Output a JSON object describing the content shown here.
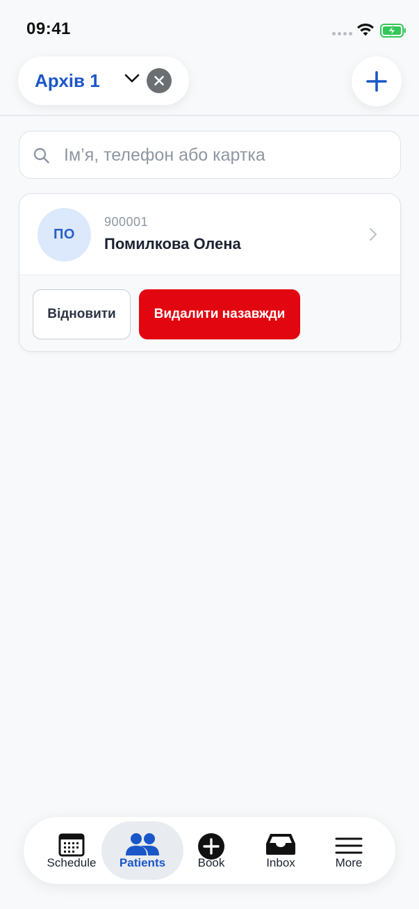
{
  "status_bar": {
    "time": "09:41"
  },
  "header": {
    "filter_label": "Архів 1",
    "icons": {
      "chevron": "chevron-down-icon",
      "clear": "close-icon",
      "add": "plus-icon"
    }
  },
  "search": {
    "placeholder": "Ім’я, телефон або картка",
    "value": ""
  },
  "patients": [
    {
      "initials": "ПО",
      "card_number": "900001",
      "name": "Помилкова Олена",
      "restore_label": "Відновити",
      "delete_label": "Видалити назавжди"
    }
  ],
  "tab_bar": {
    "tabs": [
      {
        "label": "Schedule",
        "icon": "calendar-icon",
        "active": false
      },
      {
        "label": "Patients",
        "icon": "users-icon",
        "active": true
      },
      {
        "label": "Book",
        "icon": "plus-circle-icon",
        "active": false
      },
      {
        "label": "Inbox",
        "icon": "inbox-icon",
        "active": false
      },
      {
        "label": "More",
        "icon": "menu-icon",
        "active": false
      }
    ]
  },
  "colors": {
    "accent": "#1a56c8",
    "danger": "#e20610",
    "background": "#f7f9fb"
  }
}
